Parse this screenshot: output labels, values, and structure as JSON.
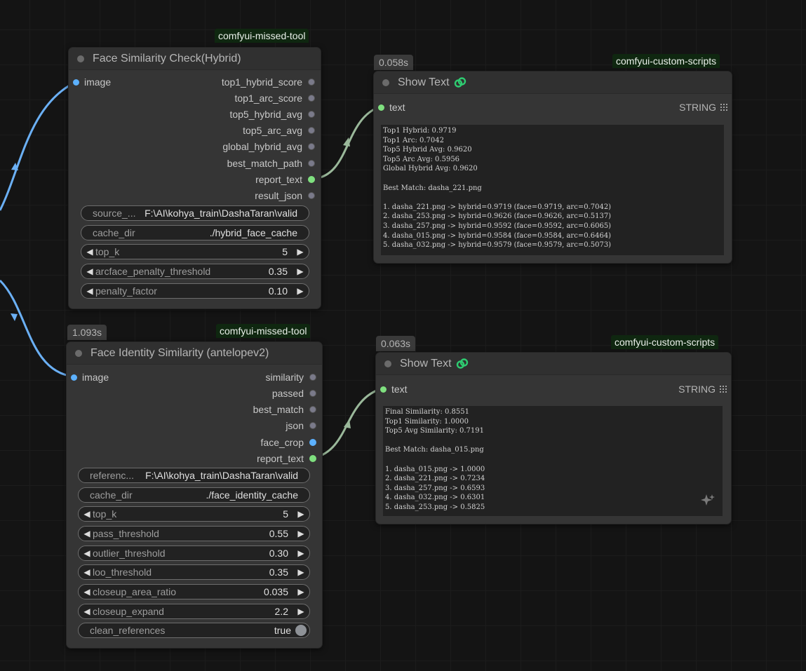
{
  "node1": {
    "source_badge": "comfyui-missed-tool",
    "title": "Face Similarity Check(Hybrid)",
    "input": "image",
    "outputs": [
      "top1_hybrid_score",
      "top1_arc_score",
      "top5_hybrid_avg",
      "top5_arc_avg",
      "global_hybrid_avg",
      "best_match_path",
      "report_text",
      "result_json"
    ],
    "widgets": {
      "source_label": "source_...",
      "source_value": "F:\\AI\\kohya_train\\DashaTaran\\valid",
      "cache_label": "cache_dir",
      "cache_value": "./hybrid_face_cache",
      "topk_label": "top_k",
      "topk_value": "5",
      "penalty_thr_label": "arcface_penalty_threshold",
      "penalty_thr_value": "0.35",
      "penalty_factor_label": "penalty_factor",
      "penalty_factor_value": "0.10"
    }
  },
  "node2": {
    "time_badge": "1.093s",
    "source_badge": "comfyui-missed-tool",
    "title": "Face Identity Similarity (antelopev2)",
    "input": "image",
    "outputs": [
      "similarity",
      "passed",
      "best_match",
      "json",
      "face_crop",
      "report_text"
    ],
    "widgets": {
      "ref_label": "referenc...",
      "ref_value": "F:\\AI\\kohya_train\\DashaTaran\\valid",
      "cache_label": "cache_dir",
      "cache_value": "./face_identity_cache",
      "topk_label": "top_k",
      "topk_value": "5",
      "pass_label": "pass_threshold",
      "pass_value": "0.55",
      "outlier_label": "outlier_threshold",
      "outlier_value": "0.30",
      "loo_label": "loo_threshold",
      "loo_value": "0.35",
      "area_label": "closeup_area_ratio",
      "area_value": "0.035",
      "expand_label": "closeup_expand",
      "expand_value": "2.2",
      "clean_label": "clean_references",
      "clean_value": "true"
    }
  },
  "show1": {
    "time_badge": "0.058s",
    "source_badge": "comfyui-custom-scripts",
    "title": "Show Text",
    "input": "text",
    "type": "STRING",
    "lines": [
      "Top1 Hybrid: 0.9719",
      "Top1 Arc: 0.7042",
      "Top5 Hybrid Avg: 0.9620",
      "Top5 Arc Avg: 0.5956",
      "Global Hybrid Avg: 0.9620",
      "",
      "Best Match: dasha_221.png",
      "",
      "1. dasha_221.png -> hybrid=0.9719 (face=0.9719, arc=0.7042)",
      "2. dasha_253.png -> hybrid=0.9626 (face=0.9626, arc=0.5137)",
      "3. dasha_257.png -> hybrid=0.9592 (face=0.9592, arc=0.6065)",
      "4. dasha_015.png -> hybrid=0.9584 (face=0.9584, arc=0.6464)",
      "5. dasha_032.png -> hybrid=0.9579 (face=0.9579, arc=0.5073)"
    ]
  },
  "show2": {
    "time_badge": "0.063s",
    "source_badge": "comfyui-custom-scripts",
    "title": "Show Text",
    "input": "text",
    "type": "STRING",
    "lines": [
      "Final Similarity: 0.8551",
      "Top1 Similarity: 1.0000",
      "Top5 Avg Similarity: 0.7191",
      "",
      "Best Match: dasha_015.png",
      "",
      "1. dasha_015.png -> 1.0000",
      "2. dasha_221.png -> 0.7234",
      "3. dasha_257.png -> 0.6593",
      "4. dasha_032.png -> 0.6301",
      "5. dasha_253.png -> 0.5825"
    ]
  },
  "icons": {
    "link": "link-icon",
    "grid": "grid-icon",
    "sparkle": "sparkle-icon"
  },
  "colors": {
    "image_wire": "#6bb0f5",
    "text_wire": "#9ab89a",
    "string_dot": "#7fe07f",
    "badge_bg": "#0f2710"
  }
}
